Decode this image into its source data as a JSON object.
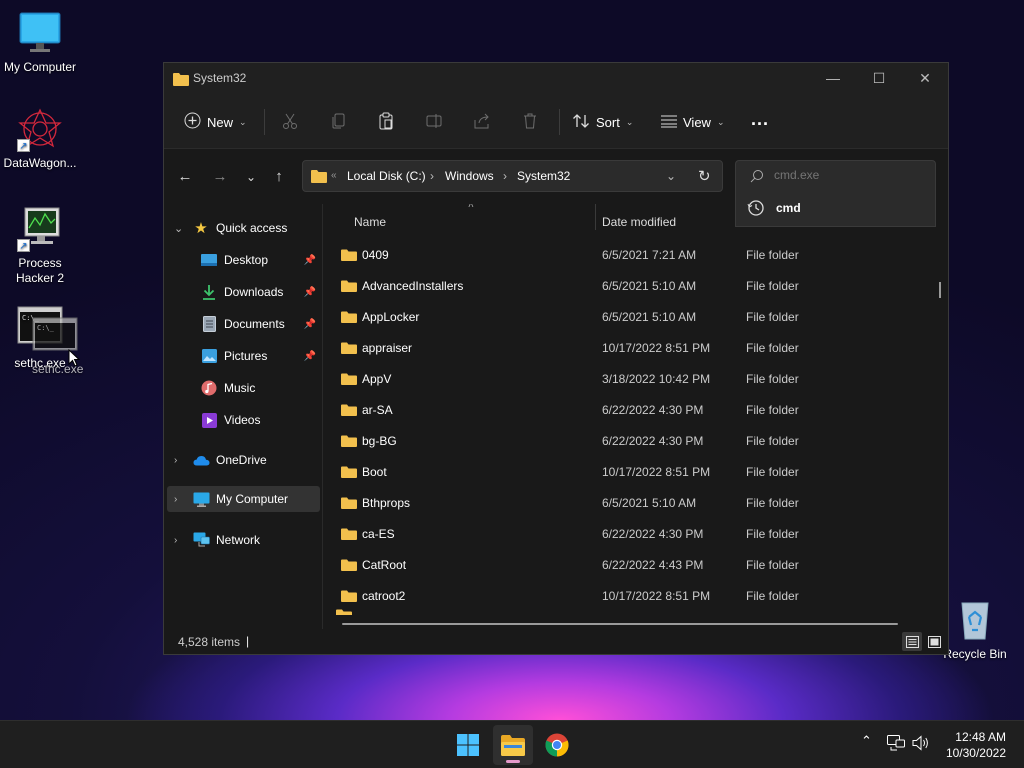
{
  "desktop": {
    "icons": [
      {
        "label": "My Computer"
      },
      {
        "label": "DataWagon..."
      },
      {
        "label": "Process Hacker 2"
      },
      {
        "label": "sethc.exe",
        "drag_label": "sethc.exe"
      },
      {
        "label": "Recycle Bin"
      }
    ]
  },
  "window": {
    "title": "System32",
    "toolbar": {
      "new_label": "New",
      "sort_label": "Sort",
      "view_label": "View",
      "more_label": "..."
    },
    "address": {
      "crumbs": [
        "Local Disk (C:)",
        "Windows",
        "System32"
      ]
    },
    "search": {
      "value": "",
      "placeholder": "cmd.exe",
      "suggestion": "cmd"
    },
    "nav_pane": {
      "quick_access": "Quick access",
      "items": [
        "Desktop",
        "Downloads",
        "Documents",
        "Pictures",
        "Music",
        "Videos"
      ],
      "onedrive": "OneDrive",
      "my_computer": "My Computer",
      "network": "Network"
    },
    "columns": {
      "name": "Name",
      "date_modified": "Date modified"
    },
    "rows": [
      {
        "name": "0409",
        "date": "6/5/2021 7:21 AM",
        "type": "File folder"
      },
      {
        "name": "AdvancedInstallers",
        "date": "6/5/2021 5:10 AM",
        "type": "File folder"
      },
      {
        "name": "AppLocker",
        "date": "6/5/2021 5:10 AM",
        "type": "File folder"
      },
      {
        "name": "appraiser",
        "date": "10/17/2022 8:51 PM",
        "type": "File folder"
      },
      {
        "name": "AppV",
        "date": "3/18/2022 10:42 PM",
        "type": "File folder"
      },
      {
        "name": "ar-SA",
        "date": "6/22/2022 4:30 PM",
        "type": "File folder"
      },
      {
        "name": "bg-BG",
        "date": "6/22/2022 4:30 PM",
        "type": "File folder"
      },
      {
        "name": "Boot",
        "date": "10/17/2022 8:51 PM",
        "type": "File folder"
      },
      {
        "name": "Bthprops",
        "date": "6/5/2021 5:10 AM",
        "type": "File folder"
      },
      {
        "name": "ca-ES",
        "date": "6/22/2022 4:30 PM",
        "type": "File folder"
      },
      {
        "name": "CatRoot",
        "date": "6/22/2022 4:43 PM",
        "type": "File folder"
      },
      {
        "name": "catroot2",
        "date": "10/17/2022 8:51 PM",
        "type": "File folder"
      }
    ],
    "status": {
      "item_count": "4,528 items",
      "separator": "|"
    }
  },
  "taskbar": {
    "time": "12:48 AM",
    "date": "10/30/2022"
  },
  "colors": {
    "folder": "#f2c04d",
    "accent": "#4cc2ff",
    "window_bg": "#191919"
  }
}
